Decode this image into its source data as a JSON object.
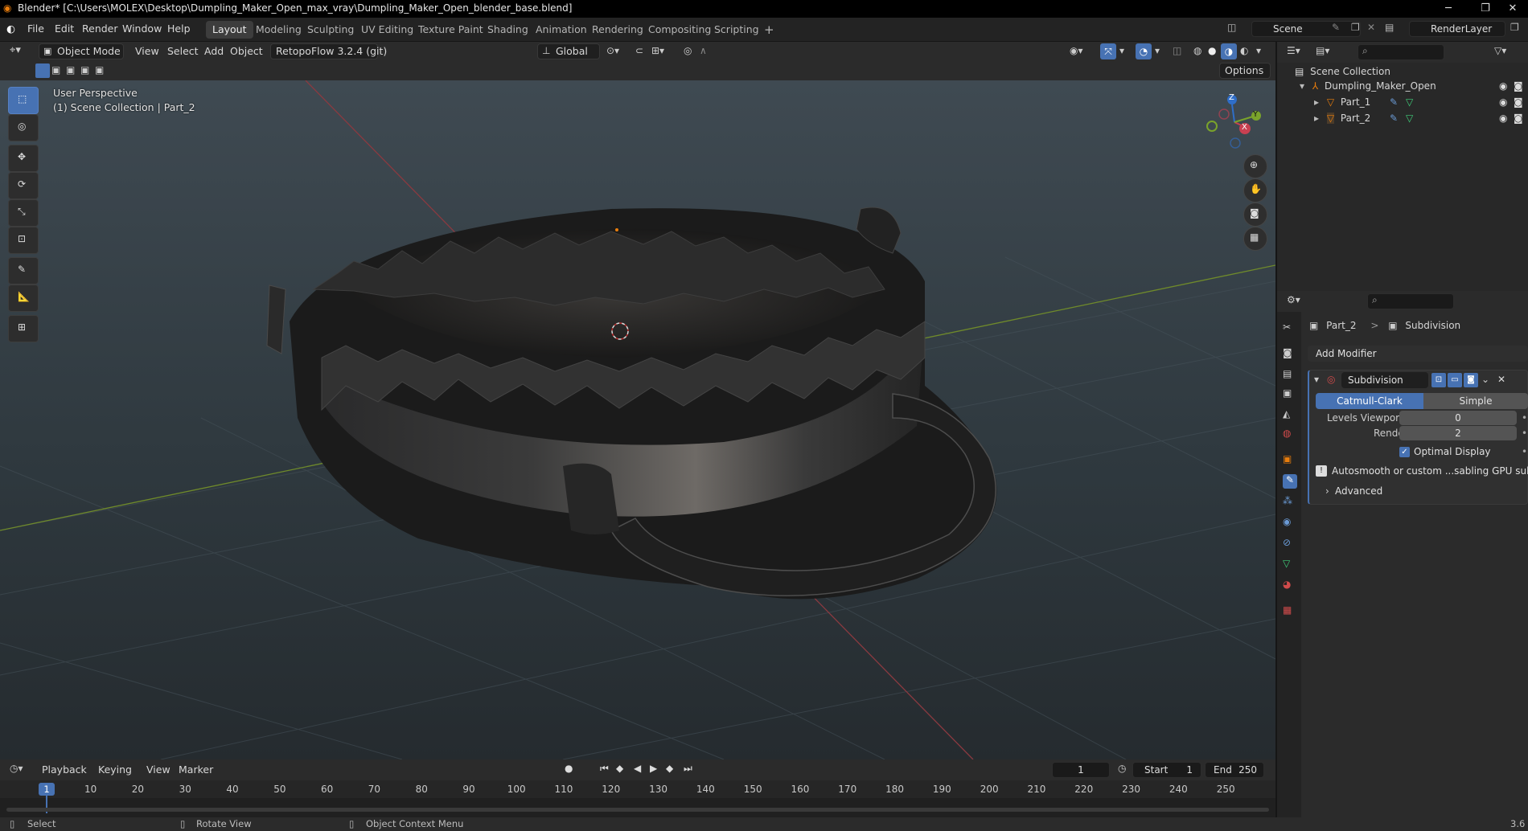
{
  "window": {
    "title": "Blender* [C:\\Users\\MOLEX\\Desktop\\Dumpling_Maker_Open_max_vray\\Dumpling_Maker_Open_blender_base.blend]",
    "minimize": "─",
    "restore": "❐",
    "close": "✕"
  },
  "menu": {
    "items": [
      "File",
      "Edit",
      "Render",
      "Window",
      "Help"
    ],
    "workspaces": [
      "Layout",
      "Modeling",
      "Sculpting",
      "UV Editing",
      "Texture Paint",
      "Shading",
      "Animation",
      "Rendering",
      "Compositing",
      "Scripting"
    ],
    "add_workspace": "+",
    "scene": "Scene",
    "render_layer": "RenderLayer"
  },
  "viewport_header": {
    "mode": "Object Mode",
    "view": "View",
    "select": "Select",
    "add": "Add",
    "object": "Object",
    "addon": "RetopoFlow 3.2.4 (git)",
    "orientation": "Global",
    "options": "Options"
  },
  "viewport": {
    "perspective_label": "User Perspective",
    "collection_label": "(1) Scene Collection | Part_2",
    "gizmo": {
      "z": "Z",
      "y": "Y",
      "x": "X"
    }
  },
  "outliner": {
    "root": "Scene Collection",
    "items": [
      {
        "name": "Dumpling_Maker_Open",
        "level": 1
      },
      {
        "name": "Part_1",
        "level": 2
      },
      {
        "name": "Part_2",
        "level": 2
      }
    ]
  },
  "properties": {
    "breadcrumb_object": "Part_2",
    "breadcrumb_sep": ">",
    "breadcrumb_modifier": "Subdivision",
    "add_modifier": "Add Modifier",
    "modifier": {
      "name": "Subdivision",
      "type_catmull": "Catmull-Clark",
      "type_simple": "Simple",
      "levels_viewport_label": "Levels Viewport",
      "levels_viewport": "0",
      "render_label": "Render",
      "render": "2",
      "optimal_display": "Optimal Display",
      "warning": "Autosmooth or custom ...sabling GPU subdivision",
      "advanced": "Advanced"
    }
  },
  "timeline": {
    "playback": "Playback",
    "keying": "Keying",
    "view": "View",
    "marker": "Marker",
    "current_frame": "1",
    "start_label": "Start",
    "start": "1",
    "end_label": "End",
    "end": "250",
    "ticks": [
      "10",
      "20",
      "30",
      "40",
      "50",
      "60",
      "70",
      "80",
      "90",
      "100",
      "110",
      "120",
      "130",
      "140",
      "150",
      "160",
      "170",
      "180",
      "190",
      "200",
      "210",
      "220",
      "230",
      "240",
      "250"
    ],
    "frame_indicator": "1"
  },
  "statusbar": {
    "select": "Select",
    "rotate": "Rotate View",
    "context": "Object Context Menu",
    "version": "3.6"
  },
  "colors": {
    "accent": "#4772b3",
    "orange": "#e87d0d",
    "x_axis": "#c94051",
    "y_axis": "#7aa32b",
    "z_axis": "#2f6ec8"
  }
}
